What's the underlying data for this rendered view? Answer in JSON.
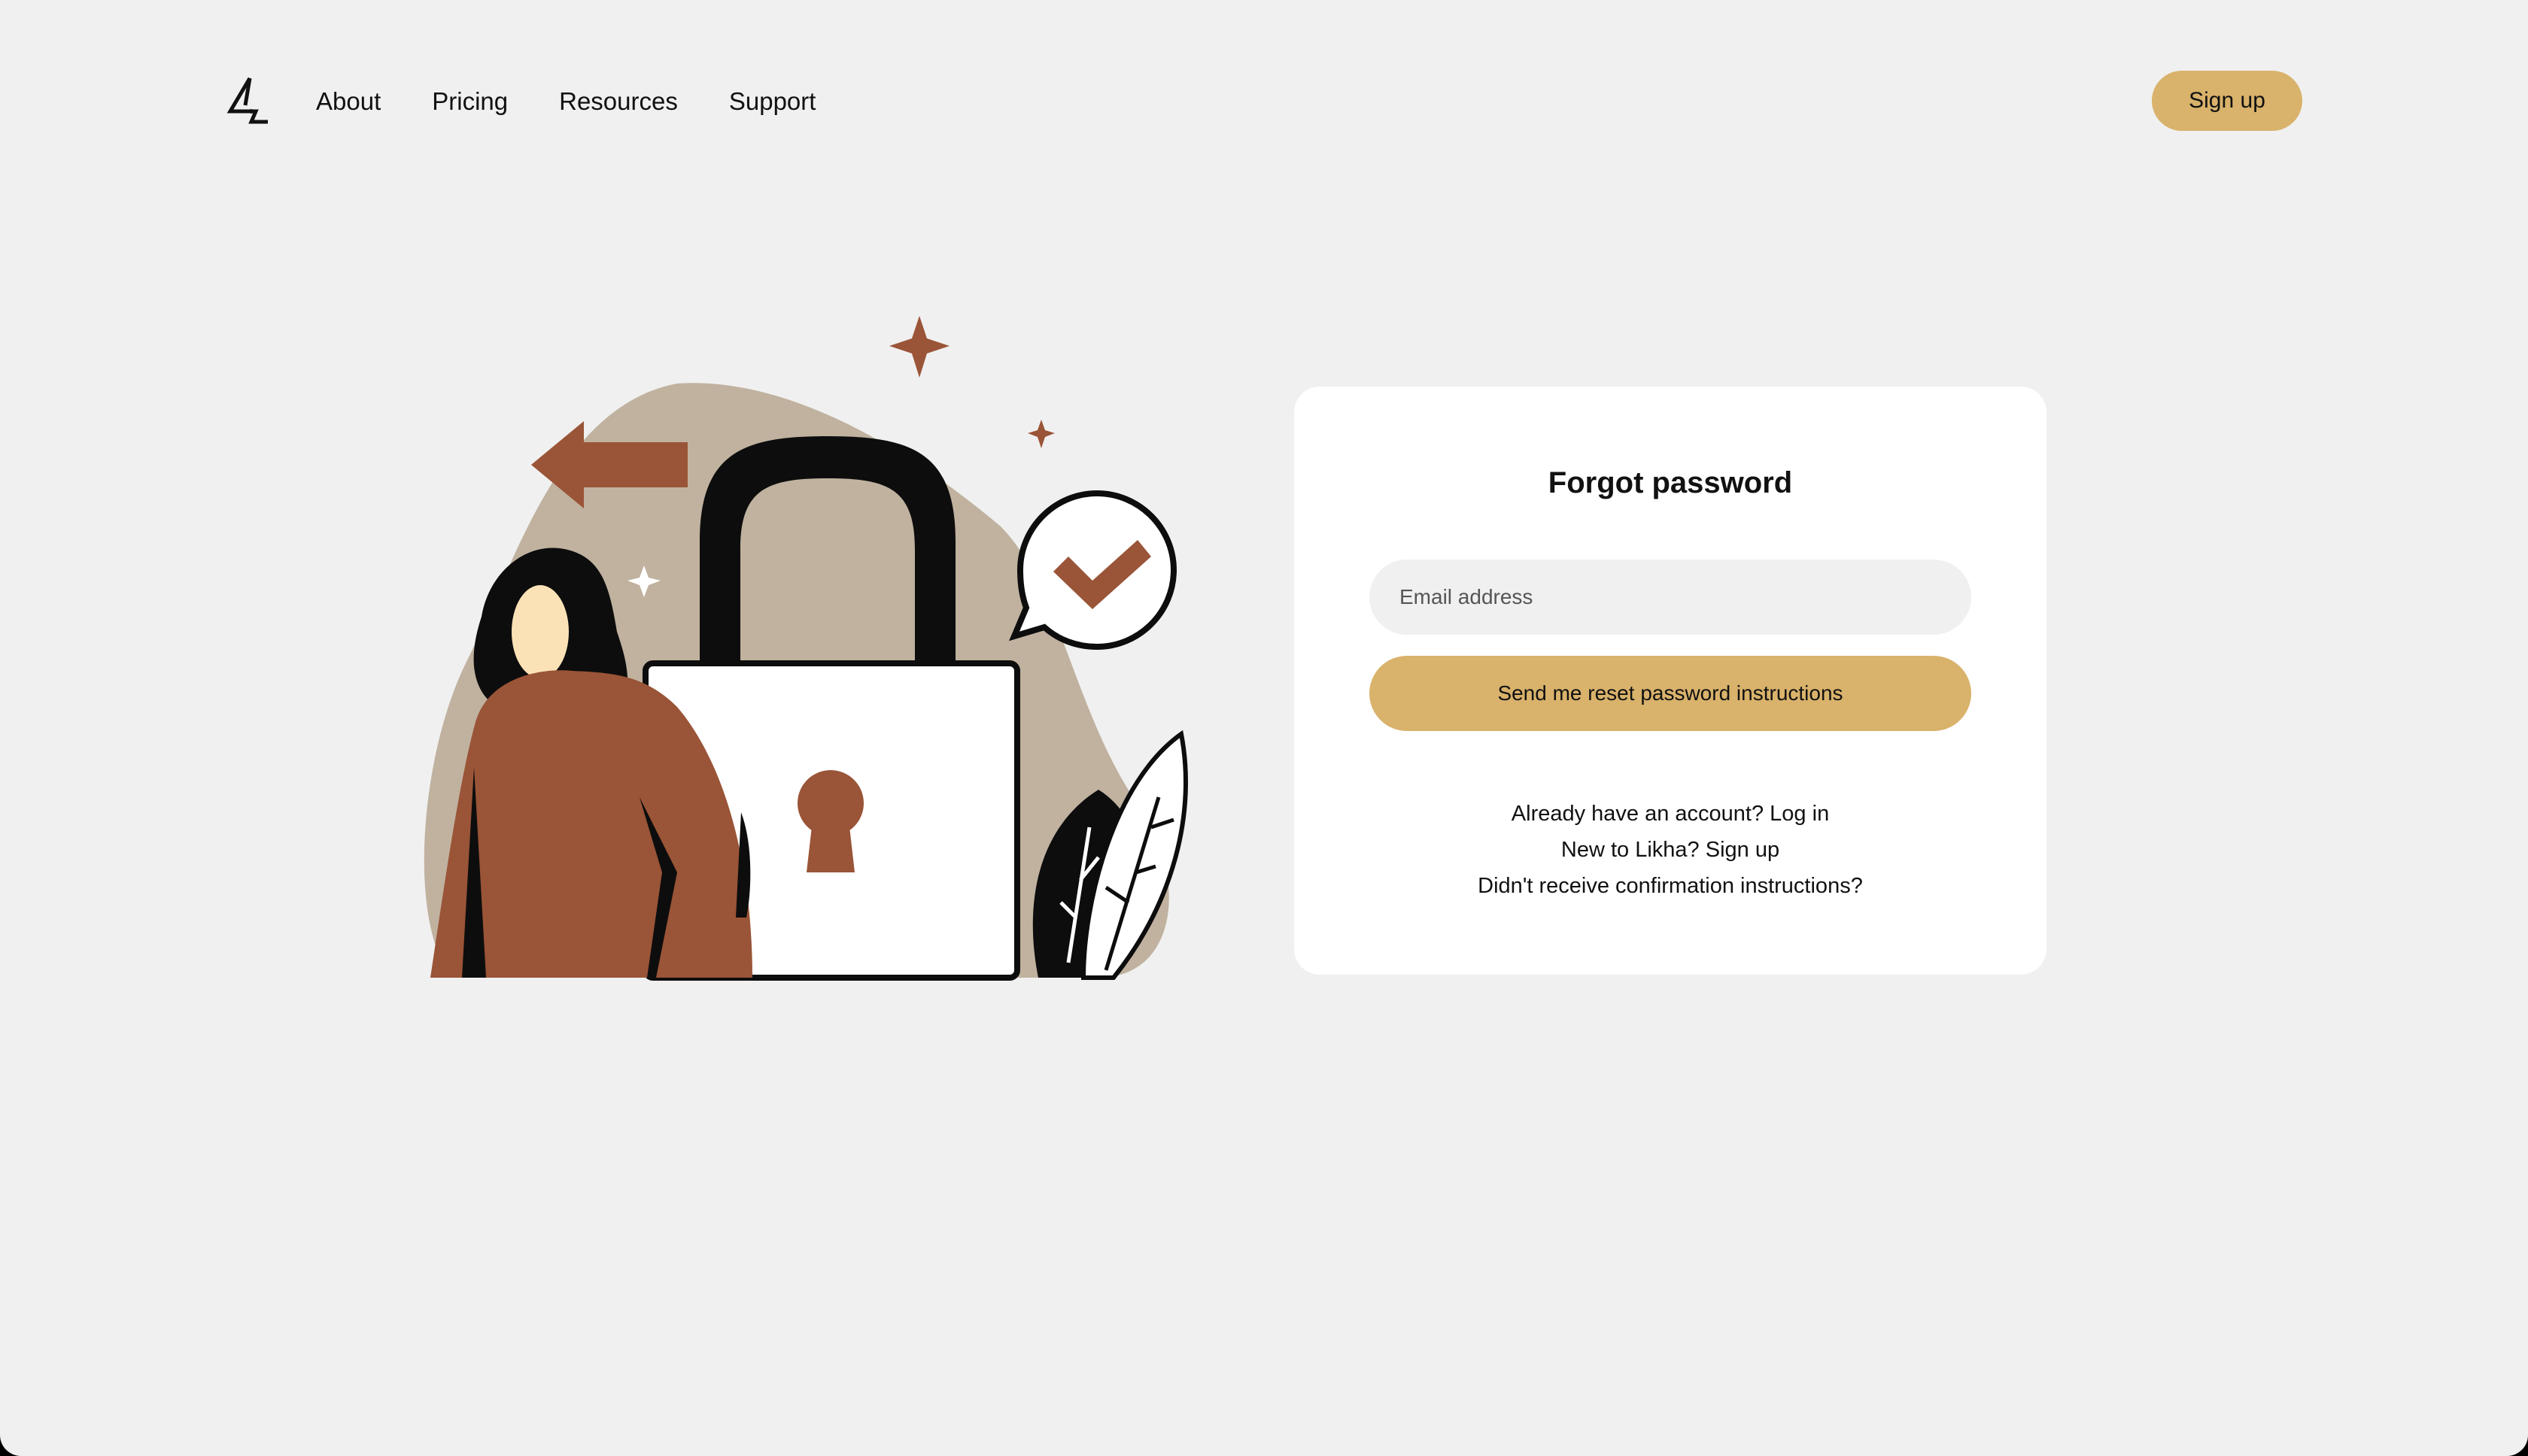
{
  "header": {
    "logo_icon": "likha-logo-icon",
    "nav": [
      {
        "label": "About"
      },
      {
        "label": "Pricing"
      },
      {
        "label": "Resources"
      },
      {
        "label": "Support"
      }
    ],
    "signup_label": "Sign up"
  },
  "illustration": {
    "icon": "padlock-woman-illustration",
    "colors": {
      "blob": "#c0b29f",
      "accent": "#9a5437",
      "skin": "#fbe2b6",
      "outline": "#0d0d0d"
    }
  },
  "form": {
    "title": "Forgot password",
    "email_placeholder": "Email address",
    "email_value": "",
    "submit_label": "Send me reset password instructions",
    "links": {
      "login": "Already have an account? Log in",
      "signup": "New to Likha? Sign up",
      "confirm": "Didn't receive confirmation instructions?"
    }
  },
  "colors": {
    "background": "#f0f0f0",
    "card": "#ffffff",
    "accent": "#d9b26b",
    "text": "#111111"
  }
}
